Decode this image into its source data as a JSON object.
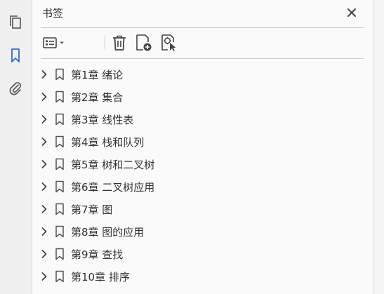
{
  "panel": {
    "title": "书签"
  },
  "bookmarks": [
    {
      "label": "第1章  绪论"
    },
    {
      "label": "第2章  集合"
    },
    {
      "label": "第3章  线性表"
    },
    {
      "label": "第4章  栈和队列"
    },
    {
      "label": "第5章  树和二叉树"
    },
    {
      "label": "第6章  二叉树应用"
    },
    {
      "label": "第7章  图"
    },
    {
      "label": "第8章  图的应用"
    },
    {
      "label": "第9章  查找"
    },
    {
      "label": "第10章  排序"
    }
  ],
  "colors": {
    "accent": "#2d6fc4",
    "icon": "#555555"
  },
  "icons": {
    "rail": [
      "pages-icon",
      "bookmark-icon",
      "attachment-icon"
    ],
    "toolbar": [
      "options-menu-icon",
      "delete-icon",
      "new-bookmark-icon",
      "bookmark-from-selection-icon"
    ]
  }
}
